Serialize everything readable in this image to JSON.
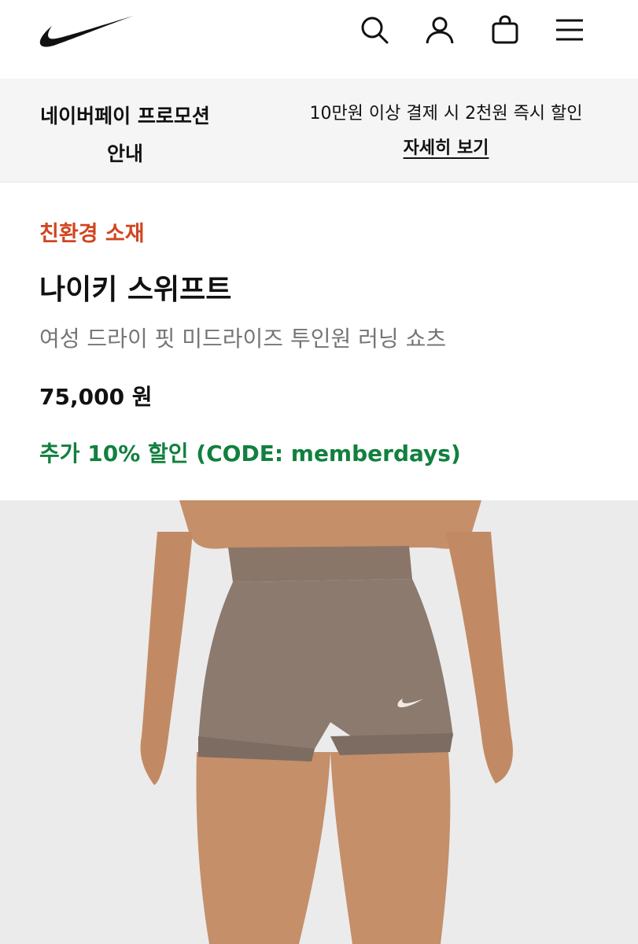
{
  "header": {
    "logo_icon": "nike-swoosh-logo",
    "icons": [
      "search-icon",
      "user-icon",
      "bag-icon",
      "menu-icon"
    ]
  },
  "promo": {
    "left_line1": "네이버페이 프로모션",
    "left_line2": "안내",
    "right_text": "10만원 이상 결제 시 2천원 즉시 할인",
    "link_label": "자세히 보기"
  },
  "product": {
    "badge": "친환경 소재",
    "name": "나이키 스위프트",
    "subtitle": "여성 드라이 핏 미드라이즈 투인원 러닝 쇼츠",
    "price": "75,000 원",
    "discount": "추가 10% 할인 (CODE: memberdays)",
    "badge_color": "#d1451f",
    "discount_color": "#11803e"
  },
  "image": {
    "subject_icon": "product-photo",
    "shorts_color": "#8c7a6e"
  }
}
